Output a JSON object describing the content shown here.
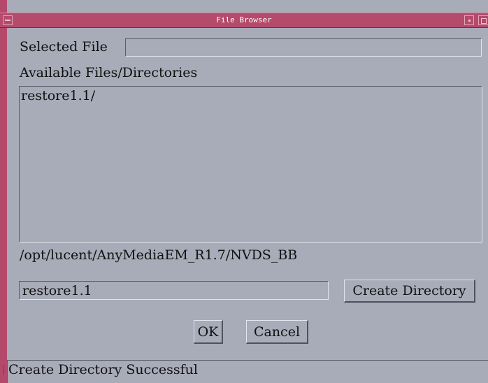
{
  "window": {
    "title": "File Browser"
  },
  "selected_file": {
    "label": "Selected File",
    "value": ""
  },
  "files": {
    "label": "Available Files/Directories",
    "items": [
      "restore1.1/"
    ]
  },
  "current_path": "/opt/lucent/AnyMediaEM_R1.7/NVDS_BB",
  "directory_name": {
    "value": "restore1.1"
  },
  "buttons": {
    "create_directory": "Create Directory",
    "ok": "OK",
    "cancel": "Cancel"
  },
  "status": "Create Directory Successful",
  "colors": {
    "titlebar": "#b44a6c",
    "background": "#a8abb8"
  }
}
